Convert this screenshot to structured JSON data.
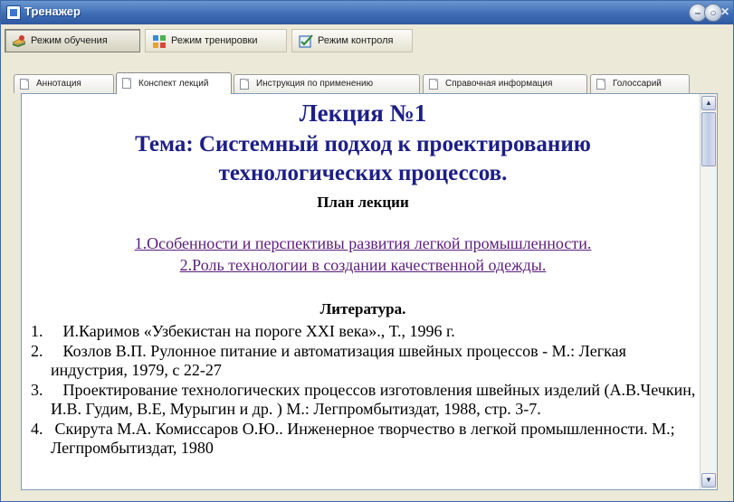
{
  "window": {
    "title": "Тренажер",
    "controls": [
      "minimize-icon",
      "maximize-icon",
      "close-icon"
    ]
  },
  "modes": [
    {
      "label": "Режим обучения",
      "icon": "learning-icon",
      "active": true
    },
    {
      "label": "Режим тренировки",
      "icon": "training-icon",
      "active": false
    },
    {
      "label": "Режим контроля",
      "icon": "checkbox-icon",
      "active": false
    }
  ],
  "tabs": [
    {
      "label": "Аннотация",
      "active": false
    },
    {
      "label": "Конспект лекций",
      "active": true
    },
    {
      "label": "Инструкция по применению",
      "active": false
    },
    {
      "label": "Справочная информация",
      "active": false
    },
    {
      "label": "Голоссарий",
      "active": false
    }
  ],
  "lecture": {
    "title": "Лекция №1",
    "topic_line1": "Тема: Системный подход к проектированию",
    "topic_line2": "технологических процессов.",
    "plan_heading": "План лекции",
    "plan_links": [
      "1.Особенности и перспективы развития легкой промышленности.",
      "2.Роль технологии в создании качественной одежды."
    ],
    "literature_heading": "Литература.",
    "literature": [
      {
        "num": "1.",
        "text": "   И.Каримов «Узбекистан на пороге XXI века»., Т., 1996 г."
      },
      {
        "num": "2.",
        "text": "   Козлов В.П. Рулонное питание и автоматизация швейных процессов - М.: Легкая индустрия, 1979, с 22-27"
      },
      {
        "num": "3.",
        "text": "   Проектирование технологических процессов изготовления швейных изделий (А.В.Чечкин, И.В. Гудим, В.Е, Мурыгин и др. ) М.: Легпромбытиздат, 1988, стр. 3-7."
      },
      {
        "num": "4.",
        "text": " Скирута М.А. Комиссаров О.Ю.. Инженерное творчество в легкой промышленности. М.; Легпромбытиздат, 1980"
      }
    ]
  },
  "colors": {
    "title_blue": "#1c1f86",
    "link_purple": "#5b1d7c",
    "titlebar": "#3e6db5"
  }
}
